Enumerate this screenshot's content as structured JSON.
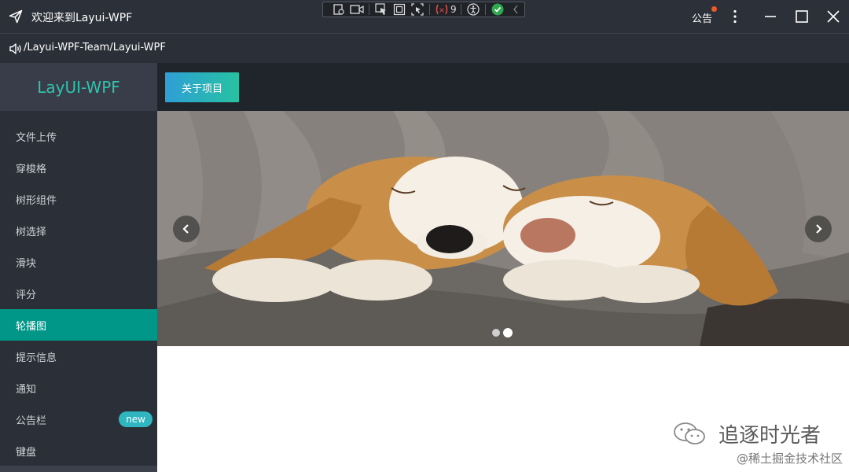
{
  "window": {
    "title": "欢迎来到Layui-WPF",
    "notice_label": "公告",
    "debug_toolbar": {
      "binding_error_count": "9",
      "icons": [
        "live-visual-tree-icon",
        "record-icon",
        "select-element-icon",
        "display-layout-adorners-icon",
        "track-focus-icon",
        "binding-failures-icon",
        "accessibility-icon",
        "hot-reload-ok-icon",
        "collapse-icon"
      ]
    },
    "controls": [
      "more-icon",
      "minimize-icon",
      "maximize-icon",
      "close-icon"
    ]
  },
  "pathbar": {
    "text": "/Layui-WPF-Team/Layui-WPF"
  },
  "sidebar": {
    "logo": "LayUI-WPF",
    "items": [
      {
        "label": "文件上传"
      },
      {
        "label": "穿梭格"
      },
      {
        "label": "树形组件"
      },
      {
        "label": "树选择"
      },
      {
        "label": "滑块"
      },
      {
        "label": "评分"
      },
      {
        "label": "轮播图",
        "active": true
      },
      {
        "label": "提示信息"
      },
      {
        "label": "通知"
      },
      {
        "label": "公告栏",
        "badge": "new"
      },
      {
        "label": "键盘"
      }
    ]
  },
  "toolbar": {
    "about_button": "关于项目"
  },
  "carousel": {
    "slide_count": 2,
    "active_index": 1
  },
  "watermark": {
    "main": "追逐时光者",
    "sub": "@稀土掘金技术社区"
  },
  "colors": {
    "accent": "#009688",
    "logo_text": "#30c3ab",
    "badge": "#2fb6c1",
    "titlebar": "#2c3139",
    "sidebar": "#2b2f37"
  }
}
